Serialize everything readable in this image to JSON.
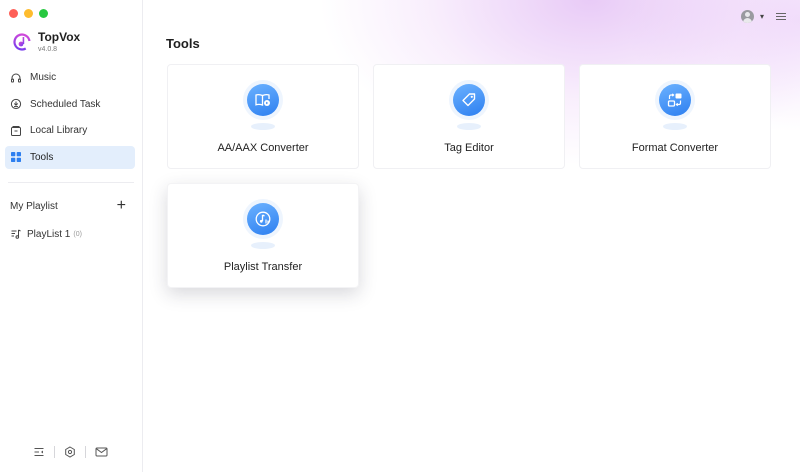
{
  "app": {
    "name": "TopVox",
    "version": "v4.0.8"
  },
  "sidebar": {
    "items": [
      {
        "label": "Music",
        "icon": "headphones-icon",
        "active": false
      },
      {
        "label": "Scheduled Task",
        "icon": "clock-download-icon",
        "active": false
      },
      {
        "label": "Local Library",
        "icon": "library-icon",
        "active": false
      },
      {
        "label": "Tools",
        "icon": "grid-icon",
        "active": true
      }
    ],
    "playlist_header": "My Playlist",
    "add_icon": "plus-icon",
    "playlists": [
      {
        "label": "PlayList 1",
        "count": "(0)",
        "icon": "music-list-icon"
      }
    ],
    "bottom_icons": [
      "collapse-sidebar-icon",
      "settings-icon",
      "mail-icon"
    ]
  },
  "topbar": {
    "avatar_icon": "user-avatar-icon",
    "dropdown_icon": "chevron-down-icon",
    "menu_icon": "hamburger-menu-icon"
  },
  "main": {
    "title": "Tools",
    "tools": [
      {
        "label": "AA/AAX Converter",
        "icon": "audiobook-icon"
      },
      {
        "label": "Tag Editor",
        "icon": "tag-icon"
      },
      {
        "label": "Format Converter",
        "icon": "format-convert-icon"
      },
      {
        "label": "Playlist Transfer",
        "icon": "playlist-transfer-icon"
      }
    ]
  },
  "colors": {
    "accent": "#2d7ff0",
    "active_bg": "#e3eefc",
    "glow": "#d6a0f0"
  }
}
